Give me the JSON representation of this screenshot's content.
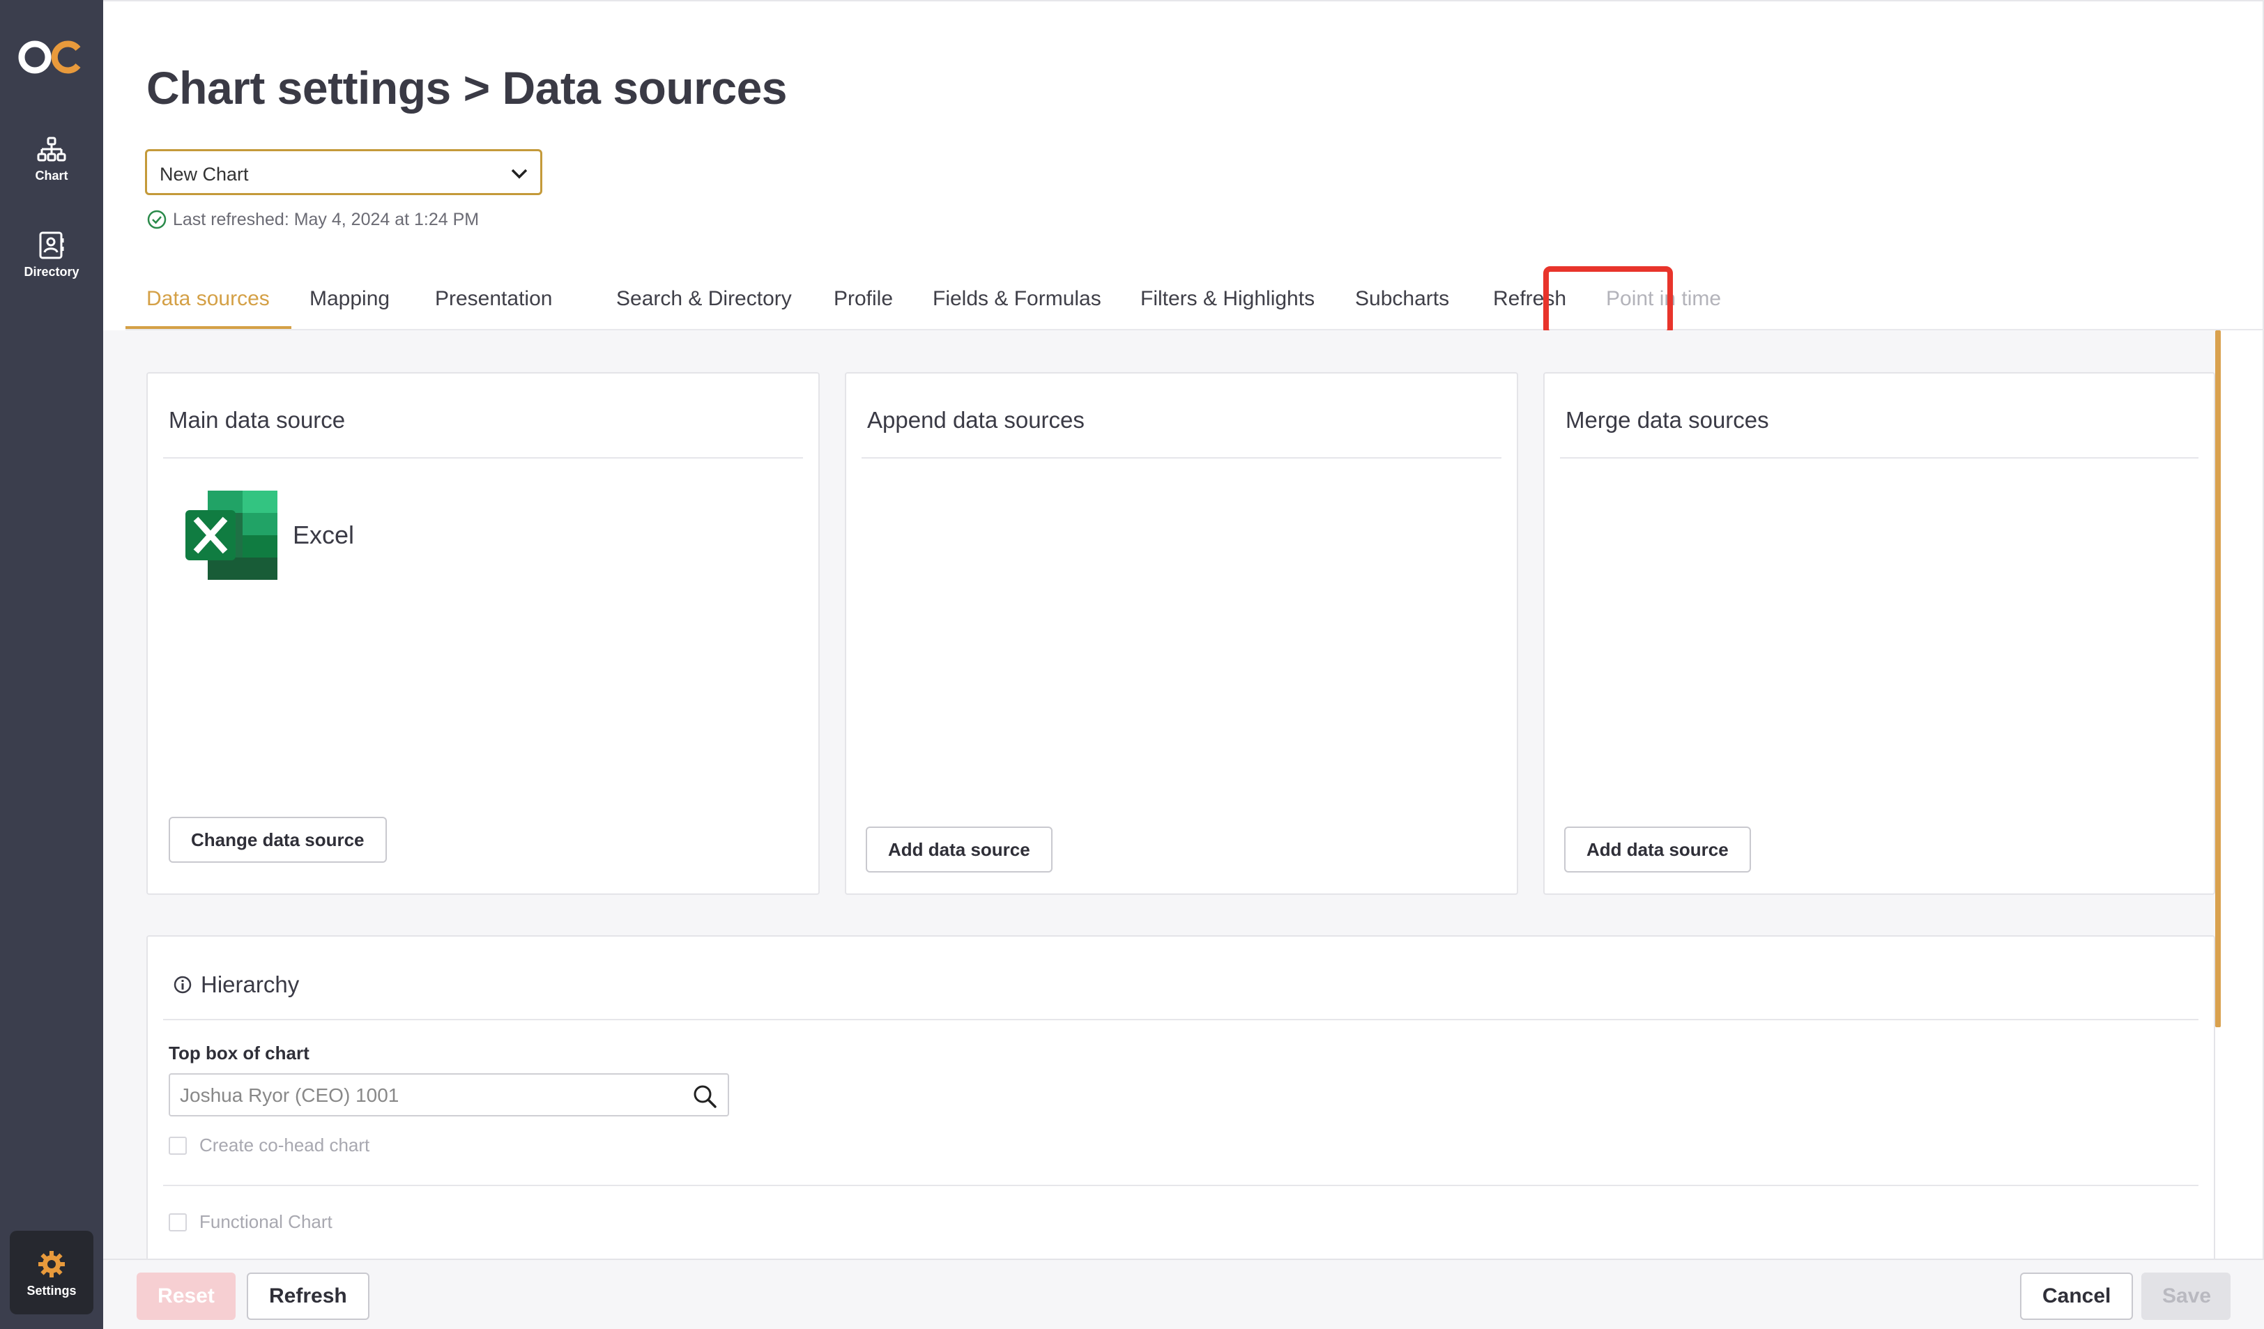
{
  "sidebar": {
    "logo_text": "OC",
    "items": [
      {
        "label": "Chart",
        "icon": "org-chart-icon"
      },
      {
        "label": "Directory",
        "icon": "contact-book-icon"
      },
      {
        "label": "Settings",
        "icon": "gear-icon"
      }
    ]
  },
  "header": {
    "title": "Chart settings > Data sources",
    "chart_select": {
      "value": "New Chart"
    },
    "last_refreshed": "Last refreshed: May 4, 2024 at 1:24 PM"
  },
  "tabs": [
    {
      "label": "Data sources",
      "state": "active"
    },
    {
      "label": "Mapping",
      "state": "normal"
    },
    {
      "label": "Presentation",
      "state": "normal"
    },
    {
      "label": "Search & Directory",
      "state": "normal"
    },
    {
      "label": "Profile",
      "state": "normal"
    },
    {
      "label": "Fields & Formulas",
      "state": "normal"
    },
    {
      "label": "Filters & Highlights",
      "state": "normal"
    },
    {
      "label": "Subcharts",
      "state": "normal"
    },
    {
      "label": "Refresh",
      "state": "highlighted"
    },
    {
      "label": "Point in time",
      "state": "disabled"
    }
  ],
  "panels": {
    "main": {
      "title": "Main data source",
      "source_name": "Excel",
      "source_icon": "excel-icon",
      "button": "Change data source"
    },
    "append": {
      "title": "Append data sources",
      "button": "Add data source"
    },
    "merge": {
      "title": "Merge data sources",
      "button": "Add data source"
    }
  },
  "hierarchy": {
    "title": "Hierarchy",
    "top_box_label": "Top box of chart",
    "top_box_value": "Joshua Ryor (CEO) 1001",
    "co_head_label": "Create co-head chart",
    "functional_label": "Functional Chart"
  },
  "footer": {
    "reset": "Reset",
    "refresh": "Refresh",
    "cancel": "Cancel",
    "save": "Save"
  },
  "colors": {
    "sidebar_bg": "#3b3e4d",
    "accent": "#d4a046",
    "highlight": "#e8342b",
    "excel_green": "#1e7145"
  }
}
